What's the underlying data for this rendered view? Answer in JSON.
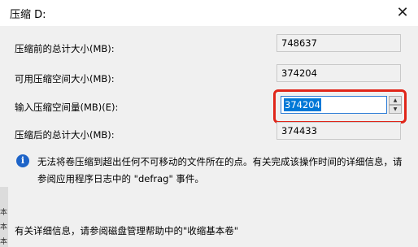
{
  "window": {
    "title": "压缩 D:"
  },
  "fields": {
    "total_before": {
      "label": "压缩前的总计大小(MB):",
      "value": "748637"
    },
    "available": {
      "label": "可用压缩空间大小(MB):",
      "value": "374204"
    },
    "input": {
      "label": "输入压缩空间量(MB)(E):",
      "value": "374204"
    },
    "total_after": {
      "label": "压缩后的总计大小(MB):",
      "value": "374433"
    }
  },
  "info": {
    "icon": "info-icon",
    "text": "无法将卷压缩到超出任何不可移动的文件所在的点。有关完成该操作时间的详细信息，请参阅应用程序日志中的 \"defrag\" 事件。"
  },
  "footer": {
    "text": "有关详细信息，请参阅磁盘管理帮助中的\"收缩基本卷\""
  },
  "colors": {
    "highlight": "#e0261a",
    "selection": "#0078d7",
    "info_icon": "#1e64c8"
  }
}
